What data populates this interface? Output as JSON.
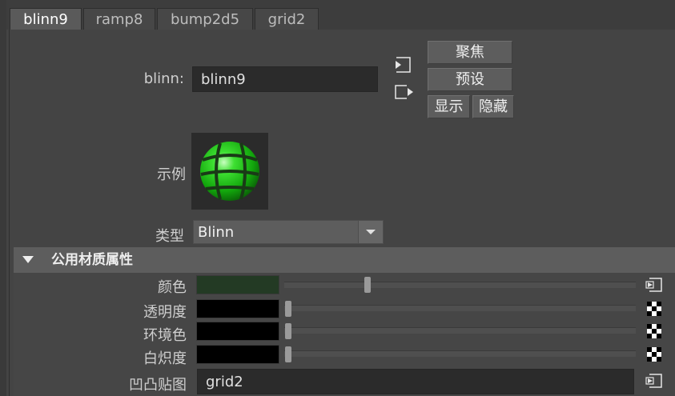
{
  "tabs": [
    {
      "label": "blinn9",
      "active": true
    },
    {
      "label": "ramp8",
      "active": false
    },
    {
      "label": "bump2d5",
      "active": false
    },
    {
      "label": "grid2",
      "active": false
    }
  ],
  "node": {
    "type_label": "blinn:",
    "name_value": "blinn9"
  },
  "buttons": {
    "focus": "聚焦",
    "presets": "预设",
    "show": "显示",
    "hide": "隐藏"
  },
  "icons": {
    "input_connections": "input-connections-icon",
    "output_connections": "output-connections-icon"
  },
  "sample": {
    "label": "示例",
    "preview_color": "#22c21c"
  },
  "material_type": {
    "label": "类型",
    "selected": "Blinn"
  },
  "section": {
    "title": "公用材质属性",
    "expanded": true
  },
  "attributes": [
    {
      "label": "颜色",
      "color": "#233a24",
      "slider": 0.23,
      "connection": "map-button-icon"
    },
    {
      "label": "透明度",
      "color": "#000000",
      "slider": 0.0,
      "connection": "checker-texture-icon"
    },
    {
      "label": "环境色",
      "color": "#000000",
      "slider": 0.0,
      "connection": "checker-texture-icon"
    },
    {
      "label": "白炽度",
      "color": "#000000",
      "slider": 0.0,
      "connection": "checker-texture-icon"
    }
  ],
  "bump": {
    "label": "凹凸贴图",
    "value": "grid2"
  }
}
